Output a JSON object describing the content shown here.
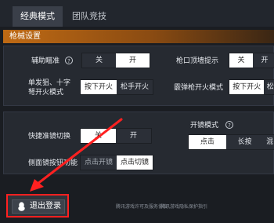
{
  "tabs": [
    "经典模式",
    "团队竞技"
  ],
  "section_title": "枪械设置",
  "settings": {
    "aim_assist": {
      "label": "辅助瞄准",
      "options": [
        "关",
        "开"
      ],
      "selected": 1
    },
    "muzzle_hint": {
      "label": "枪口顶墙提示",
      "options": [
        "关",
        "开"
      ],
      "selected": 0
    },
    "fire_mode": {
      "label_line1": "单发狙、十字",
      "label_line2": "弩开火模式",
      "options": [
        "按下开火",
        "松手开火"
      ],
      "selected": 0
    },
    "shotgun_fire": {
      "label": "霰弹枪开火模式",
      "options": [
        "按下开火",
        "松"
      ],
      "selected": 0
    },
    "quick_scope": {
      "label": "快捷准镜切换",
      "options": [
        "关",
        "开"
      ],
      "selected": 0
    },
    "scope_mode": {
      "label": "开镜模式",
      "options": [
        "点击",
        "长按",
        "混"
      ],
      "selected": 0
    },
    "side_scope": {
      "label": "侧面镜按钮功能",
      "options": [
        "点击开镜",
        "点击切镜"
      ],
      "selected": 1
    }
  },
  "logout_label": "退出登录",
  "footer_links": [
    "腾讯游戏许可及服务协议",
    "腾讯游戏隐私保护指引"
  ],
  "colors": {
    "accent": "#c7701a",
    "highlight": "#ff2020"
  }
}
